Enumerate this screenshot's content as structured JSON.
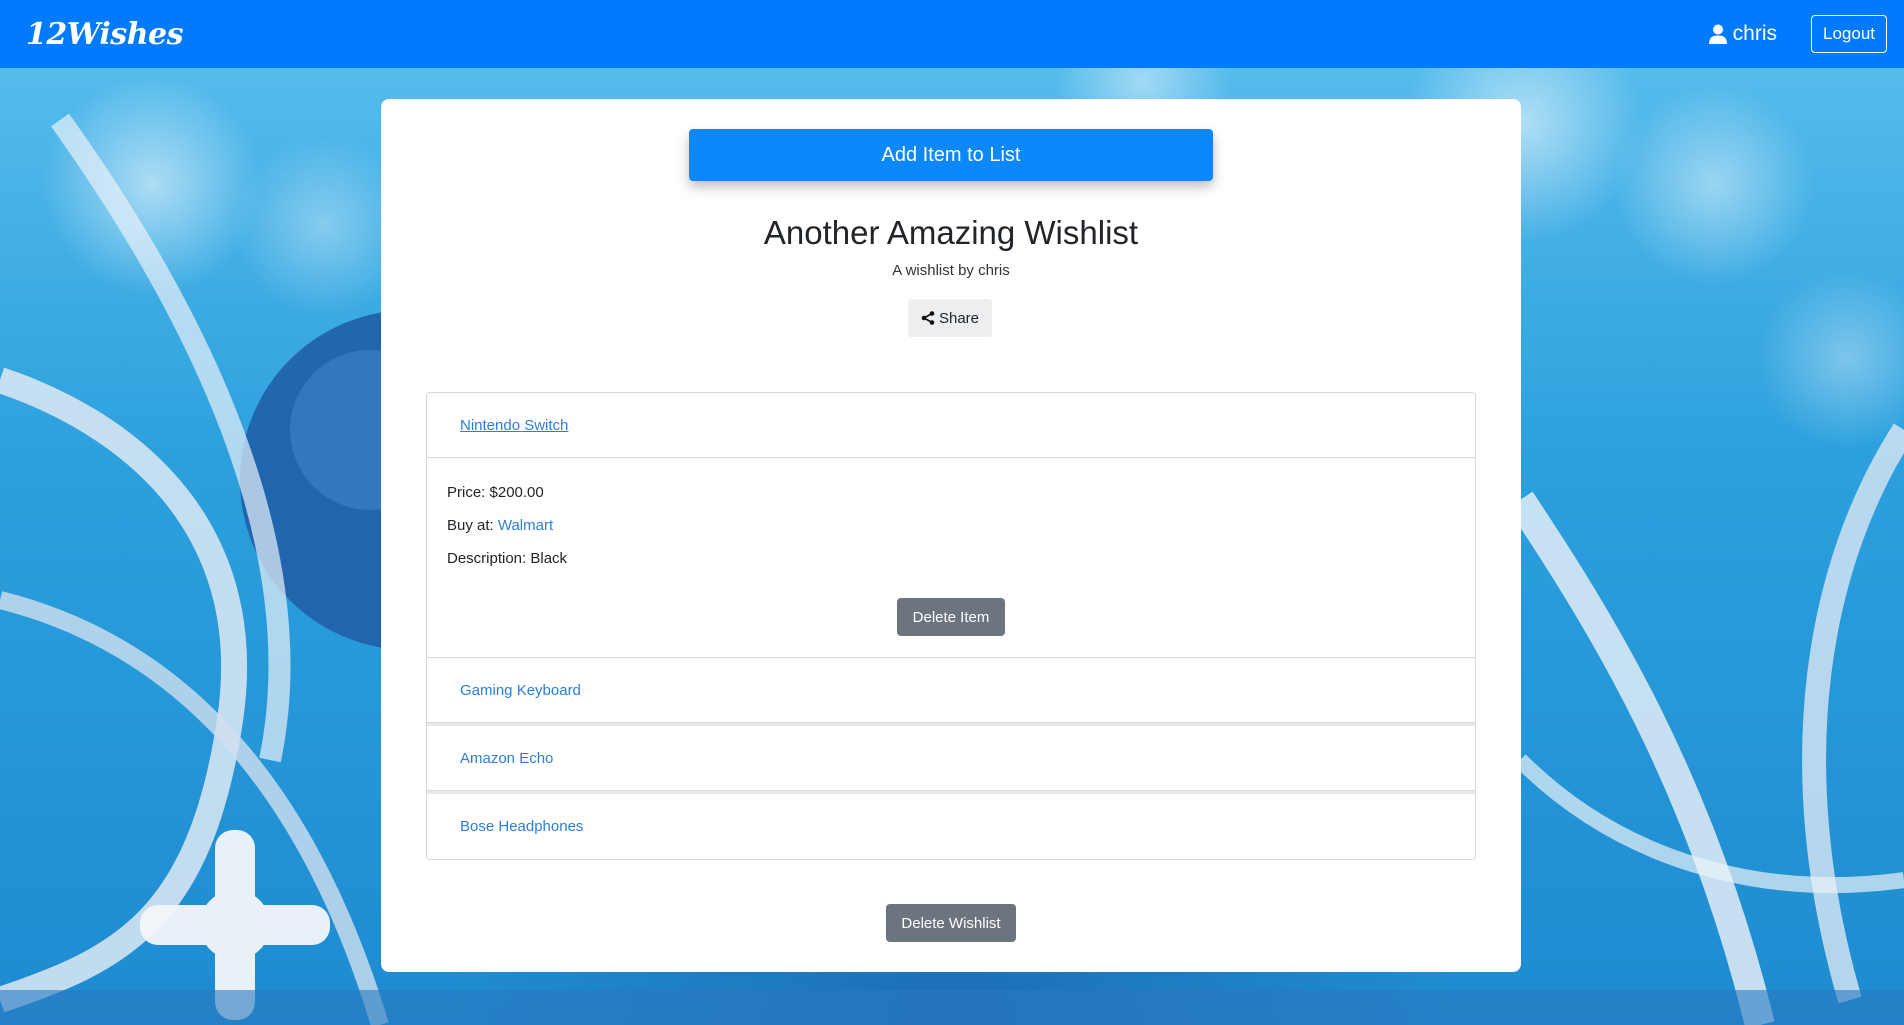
{
  "navbar": {
    "brand": "12Wishes",
    "username": "chris",
    "logout_label": "Logout"
  },
  "wishlist": {
    "add_item_label": "Add Item to List",
    "title": "Another Amazing Wishlist",
    "subtitle": "A wishlist by chris",
    "share_label": "Share",
    "delete_wishlist_label": "Delete Wishlist",
    "items": [
      {
        "name": "Nintendo Switch",
        "expanded": true,
        "price_label": "Price: $200.00",
        "buy_at_prefix": "Buy at: ",
        "buy_at_store": "Walmart",
        "description_label": "Description: Black",
        "delete_label": "Delete Item"
      },
      {
        "name": "Gaming Keyboard",
        "expanded": false
      },
      {
        "name": "Amazon Echo",
        "expanded": false
      },
      {
        "name": "Bose Headphones",
        "expanded": false
      }
    ]
  },
  "colors": {
    "primary": "#007bff",
    "secondary": "#6c757d",
    "link": "#2b7fd6"
  },
  "icons": {
    "user": "user-icon",
    "share": "share-icon"
  }
}
